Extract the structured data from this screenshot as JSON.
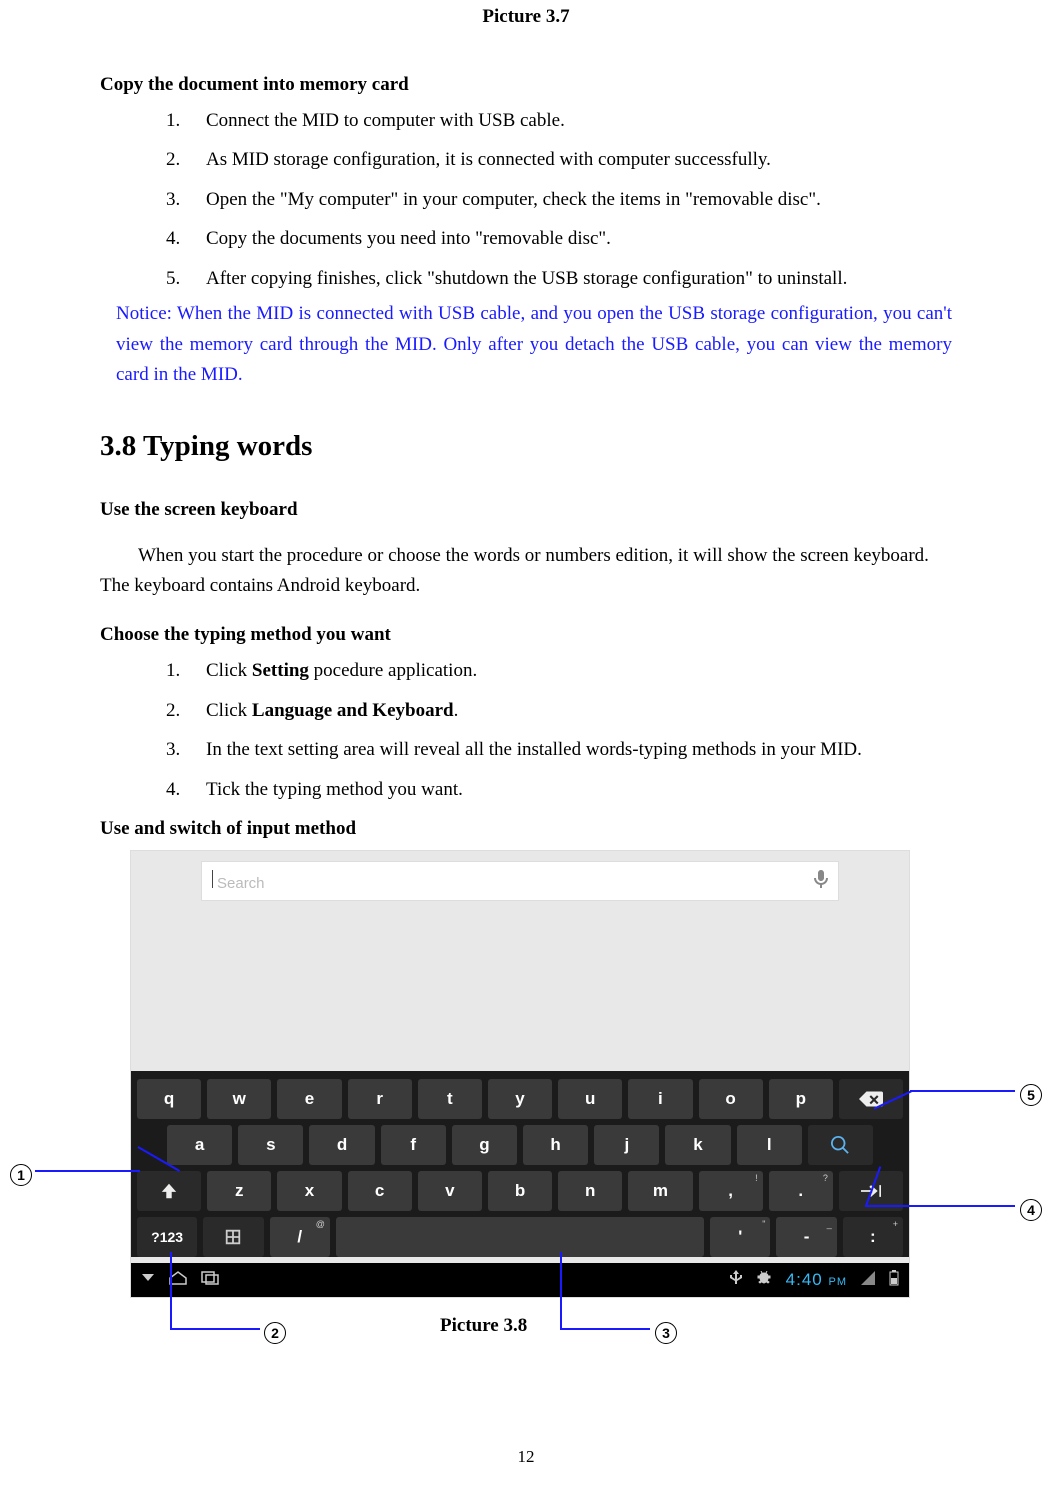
{
  "caption_top": "Picture 3.7",
  "copy_heading": "Copy the document into memory card",
  "copy_steps": [
    "Connect the MID to computer with USB cable.",
    "As MID storage configuration, it is connected with computer successfully.",
    "Open the \"My computer\" in your computer, check the items in \"removable disc\".",
    "Copy the documents you need into \"removable disc\".",
    "After copying finishes, click \"shutdown the USB storage configuration\" to uninstall."
  ],
  "notice": "Notice: When the MID is connected with USB cable, and you open the USB storage configuration, you can't view the memory card through the MID. Only after you detach the USB cable, you can view the memory card in the MID.",
  "section_heading": "3.8 Typing words",
  "use_keyboard_heading": "Use the screen keyboard",
  "use_keyboard_body": "When you start the procedure or choose the words or numbers edition, it will show the screen keyboard. The keyboard contains Android keyboard.",
  "choose_heading": "Choose the typing method you want",
  "choose_steps_pre": [
    "Click ",
    "Click ",
    "In the text setting area will reveal all the installed words-typing methods in your MID.",
    "Tick the typing method you want."
  ],
  "choose_bold_1": "Setting",
  "choose_post_1": " pocedure application.",
  "choose_bold_2": "Language and Keyboard",
  "choose_post_2": ".",
  "switch_heading": "Use and switch of input method",
  "search_placeholder": "Search",
  "keyboard": {
    "row1": [
      "q",
      "w",
      "e",
      "r",
      "t",
      "y",
      "u",
      "i",
      "o",
      "p"
    ],
    "row2": [
      "a",
      "s",
      "d",
      "f",
      "g",
      "h",
      "j",
      "k",
      "l"
    ],
    "row3": [
      "z",
      "x",
      "c",
      "v",
      "b",
      "n",
      "m",
      ",",
      "."
    ],
    "row4_numkey": "?123",
    "row4_slash": "/",
    "row4_slash_sup": "@",
    "row4_apos": "'",
    "row4_apos_sup": "\"",
    "row4_dash": "-",
    "row4_dash_sup": "_",
    "row4_colon": ":",
    "row4_colon_sup": "+",
    "period_sup": "?",
    "comma_sup": "!"
  },
  "statusbar_time": "4:40",
  "statusbar_ampm": "PM",
  "callouts": {
    "c1": "1",
    "c2": "2",
    "c3": "3",
    "c4": "4",
    "c5": "5"
  },
  "caption_bottom": "Picture 3.8",
  "page_number": "12"
}
